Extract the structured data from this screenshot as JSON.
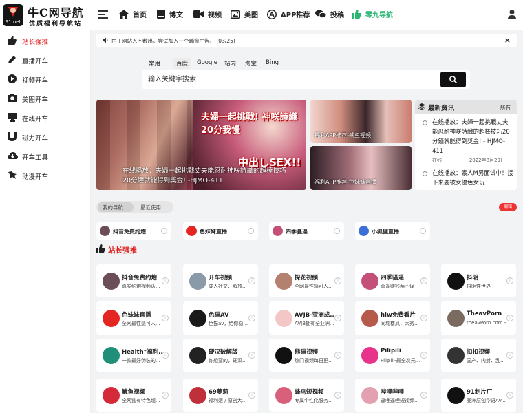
{
  "logo": {
    "title": "牛C网导航",
    "subtitle": "优质福利导航站",
    "badge": "91.net"
  },
  "nav": [
    {
      "label": "首页",
      "icon": "home-icon"
    },
    {
      "label": "博文",
      "icon": "book-icon"
    },
    {
      "label": "视频",
      "icon": "video-icon"
    },
    {
      "label": "美图",
      "icon": "image-icon"
    },
    {
      "label": "APP推荐",
      "icon": "app-icon"
    },
    {
      "label": "投稿",
      "icon": "chat-icon"
    },
    {
      "label": "零九导航",
      "icon": "thumb-up-icon",
      "color": "#2bb673"
    }
  ],
  "sidebar": [
    {
      "label": "站长强推",
      "icon": "thumb-up-icon",
      "active": true
    },
    {
      "label": "直播开车",
      "icon": "pen-icon"
    },
    {
      "label": "视频开车",
      "icon": "play-icon"
    },
    {
      "label": "美图开车",
      "icon": "camera-icon"
    },
    {
      "label": "在线开车",
      "icon": "monitor-icon"
    },
    {
      "label": "磁力开车",
      "icon": "magnet-icon"
    },
    {
      "label": "开车工具",
      "icon": "cloud-download-icon"
    },
    {
      "label": "动漫开车",
      "icon": "dragon-icon"
    }
  ],
  "notice": {
    "text": "由于网站入不敷出，尝试加入一个蹦窗广告。 (03/25)",
    "close": "×"
  },
  "search": {
    "tabs": [
      "常用",
      "百度",
      "Google",
      "站内",
      "淘宝",
      "Bing"
    ],
    "active_tab": "百度",
    "placeholder": "输入关键字搜索"
  },
  "banners": {
    "main_caption": "在线播放：夫婦一起挑戰丈夫能忍耐神咲詩織的超棒技巧20分鐘就能得到獎金! -HJMO-411",
    "main_headline": "夫婦一起挑戰! 神咲詩織 20分我慢",
    "main_headline2": "中出しSEX!!",
    "small1_caption": "福利APP推荐-鱿鱼视频",
    "small2_caption": "福利APP推荐-色妹妹直播"
  },
  "news": {
    "title": "最新资讯",
    "all": "所有",
    "items": [
      {
        "text": "在线播放：夫婦一起挑戰丈夫能忍耐神咲詩織的超棒技巧20分鐘就能得到獎金! - HJMO-411",
        "category": "在线",
        "date": "2022年8月29日"
      },
      {
        "text": "在线播放：素人M男面试中！接下来要被女優色女玩"
      }
    ]
  },
  "tabs2": {
    "items": [
      "我的导航",
      "最近使用"
    ],
    "active": 0,
    "badge": "编辑"
  },
  "quick": [
    {
      "name": "抖音免费约炮",
      "color": "#6b4e58"
    },
    {
      "name": "色妹妹直播",
      "color": "#e52521"
    },
    {
      "name": "四季骚逼",
      "color": "#c4507a"
    },
    {
      "name": "小狐狸直播",
      "color": "#3a6fd8"
    }
  ],
  "section": {
    "title": "站长强推"
  },
  "cards": [
    {
      "name": "抖音免费约炮",
      "desc": "真实约炮视频认...",
      "color": "#6b4e58"
    },
    {
      "name": "开车视频",
      "desc": "成人社交、解放...",
      "color": "#8a9aa8"
    },
    {
      "name": "探花视频",
      "desc": "全网最性感可人...",
      "color": "#b48070"
    },
    {
      "name": "四季骚逼",
      "desc": "草逼赚钱两不误",
      "color": "#c4507a"
    },
    {
      "name": "抖阴",
      "desc": "抖阴性世界",
      "color": "#111111"
    },
    {
      "name": "色妹妹直播",
      "desc": "全网最性感可人...",
      "color": "#e52521"
    },
    {
      "name": "色猫AV",
      "desc": "色猫av，给你稳...",
      "color": "#1a1a1a"
    },
    {
      "name": "AVJB-亚洲成...",
      "desc": "AVJB拥有全亚洲...",
      "color": "#f4c7c7"
    },
    {
      "name": "hlw免费看片",
      "desc": "同城楼凤，大秀...",
      "color": "#b65a4c"
    },
    {
      "name": "TheavPorn",
      "desc": "theavPorn.com -...",
      "color": "#7a6a60"
    },
    {
      "name": "Health⁺福利...",
      "desc": "一款最好伪装的...",
      "color": "#1f8f7a"
    },
    {
      "name": "硬汉破解版",
      "desc": "你想要的，硬汉...",
      "color": "#222222"
    },
    {
      "name": "熊猫视频",
      "desc": "热门视频每日更...",
      "color": "#111111"
    },
    {
      "name": "Pilipili",
      "desc": "Pilipili-最全次元...",
      "color": "#e8338a"
    },
    {
      "name": "扣扣视频",
      "desc": "国产、内射、乱...",
      "color": "#333333"
    },
    {
      "name": "鱿鱼视频",
      "desc": "全网独有特色超...",
      "color": "#d42a3a"
    },
    {
      "name": "69萝莉",
      "desc": "福利姬 / 原创大...",
      "color": "#c0303a"
    },
    {
      "name": "蜂鸟短视频",
      "desc": "专属个性化服务...",
      "color": "#d8607a"
    },
    {
      "name": "哔哩哔哩",
      "desc": "逼哩逼哩短视频...",
      "color": "#e2a0b0"
    },
    {
      "name": "91制片厂",
      "desc": "亚洲原创华语AV...",
      "color": "#111111"
    }
  ]
}
